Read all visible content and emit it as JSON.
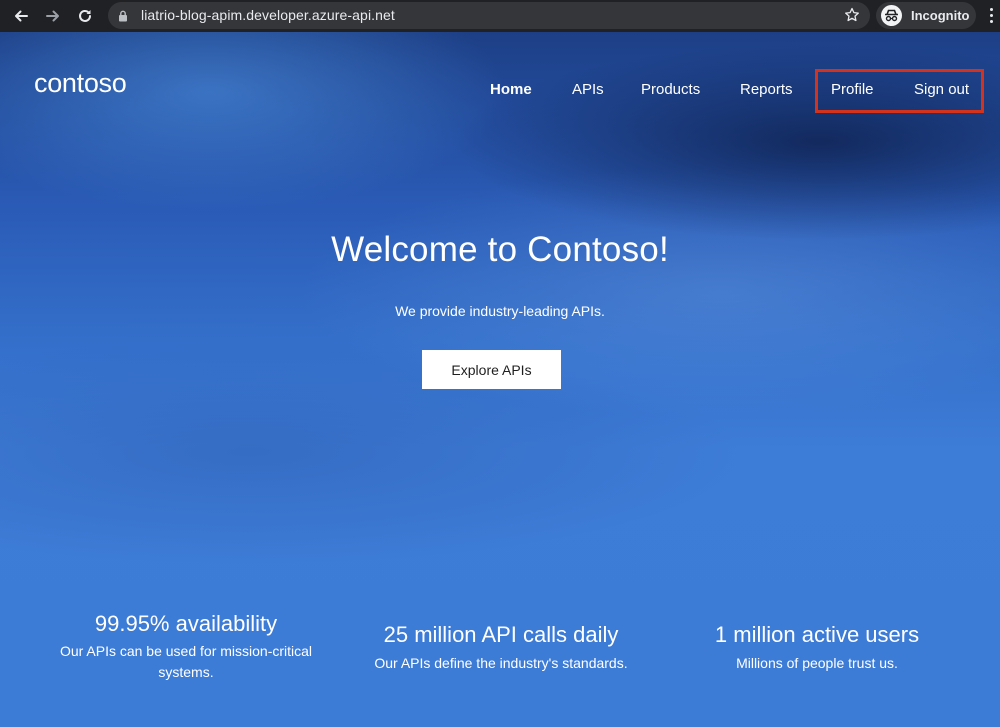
{
  "browser": {
    "url": "liatrio-blog-apim.developer.azure-api.net",
    "incognito_label": "Incognito"
  },
  "site": {
    "logo": "contoso",
    "nav": {
      "home": "Home",
      "apis": "APIs",
      "products": "Products",
      "reports": "Reports",
      "profile": "Profile",
      "sign_out": "Sign out"
    }
  },
  "hero": {
    "title": "Welcome to Contoso!",
    "subtitle": "We provide industry-leading APIs.",
    "cta": "Explore APIs"
  },
  "stats": [
    {
      "title": "99.95% availability",
      "desc": "Our APIs can be used for mission-critical systems."
    },
    {
      "title": "25 million API calls daily",
      "desc": "Our APIs define the industry's standards."
    },
    {
      "title": "1 million active users",
      "desc": "Millions of people trust us."
    }
  ],
  "colors": {
    "highlight": "#d3321c",
    "hero_blue": "#3c7bd6",
    "chrome_dark": "#202124"
  }
}
